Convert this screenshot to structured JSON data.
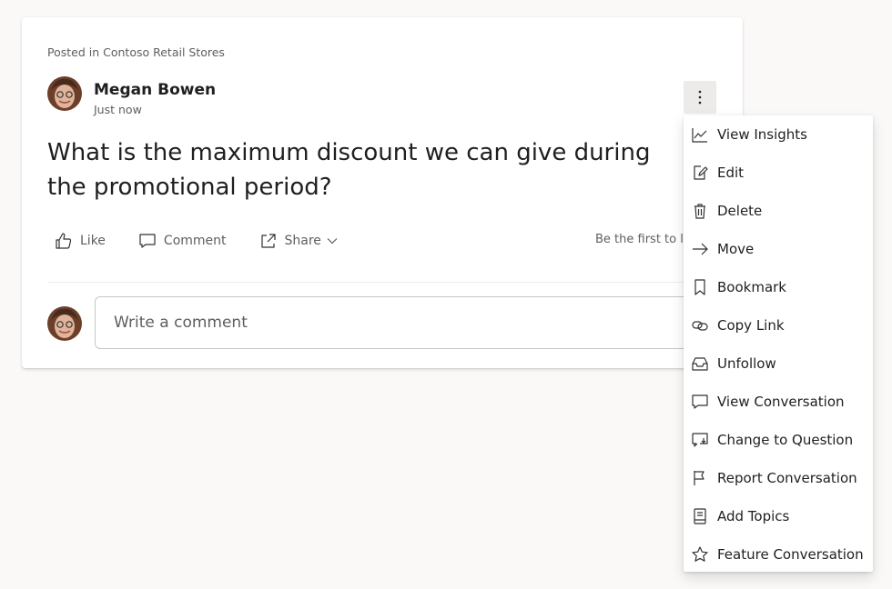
{
  "post": {
    "posted_in": "Posted in Contoso Retail Stores",
    "author": "Megan Bowen",
    "timestamp": "Just now",
    "question": "What is the maximum discount we can give during the promotional period?",
    "like_label": "Like",
    "comment_label": "Comment",
    "share_label": "Share",
    "first_like_text": "Be the first to like this"
  },
  "comment": {
    "placeholder": "Write a comment"
  },
  "menu": {
    "items": [
      {
        "label": "View Insights",
        "icon": "chart-line-icon"
      },
      {
        "label": "Edit",
        "icon": "edit-icon"
      },
      {
        "label": "Delete",
        "icon": "delete-icon"
      },
      {
        "label": "Move",
        "icon": "arrow-right-icon"
      },
      {
        "label": "Bookmark",
        "icon": "bookmark-icon"
      },
      {
        "label": "Copy Link",
        "icon": "link-icon"
      },
      {
        "label": "Unfollow",
        "icon": "inbox-icon"
      },
      {
        "label": "View Conversation",
        "icon": "chat-icon"
      },
      {
        "label": "Change to Question",
        "icon": "chat-question-icon"
      },
      {
        "label": "Report Conversation",
        "icon": "flag-icon"
      },
      {
        "label": "Add Topics",
        "icon": "book-icon"
      },
      {
        "label": "Feature Conversation",
        "icon": "star-icon"
      }
    ]
  }
}
